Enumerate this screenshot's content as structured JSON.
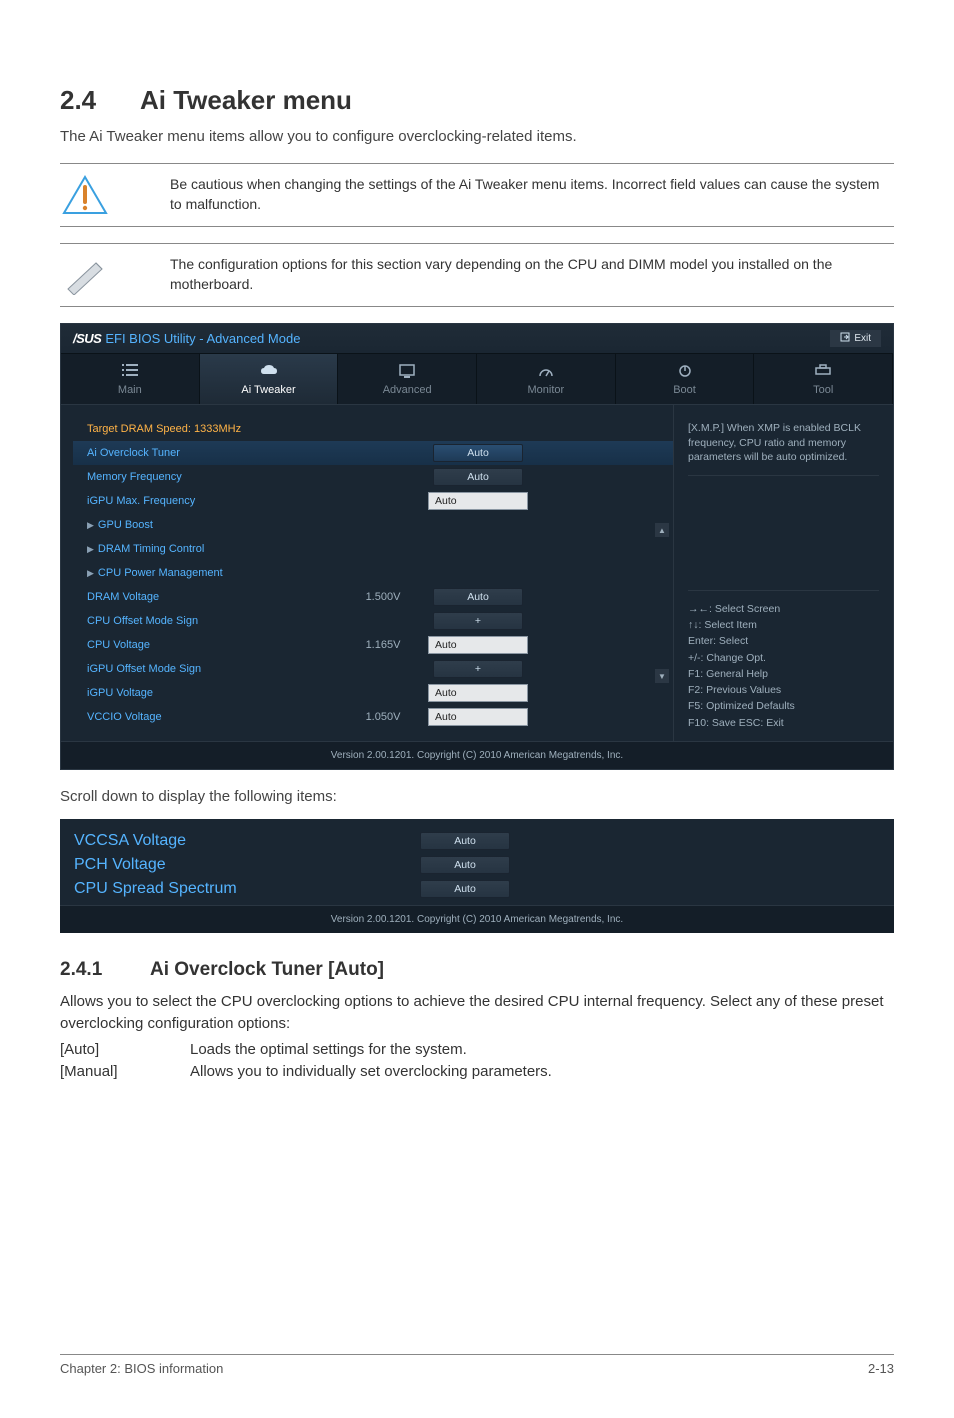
{
  "heading": {
    "num": "2.4",
    "title": "Ai Tweaker menu"
  },
  "intro": "The Ai Tweaker menu items allow you to configure overclocking-related items.",
  "note1": "Be cautious when changing the settings of the Ai Tweaker menu items. Incorrect field values can cause the system to malfunction.",
  "note2": "The configuration options for this section vary depending on the CPU and DIMM model you installed on the motherboard.",
  "bios": {
    "brand": "/SUS",
    "title": "EFI BIOS Utility - Advanced Mode",
    "exit": "Exit",
    "tabs": {
      "main": "Main",
      "tweaker": "Ai  Tweaker",
      "advanced": "Advanced",
      "monitor": "Monitor",
      "boot": "Boot",
      "tool": "Tool"
    },
    "rows": {
      "target_dram": "Target DRAM Speed: 1333MHz",
      "ai_overclock": "Ai Overclock Tuner",
      "mem_freq": "Memory Frequency",
      "igpu_max": "iGPU Max. Frequency",
      "gpu_boost": "GPU Boost",
      "dram_timing": "DRAM Timing Control",
      "cpu_pm": "CPU Power Management",
      "dram_voltage": "DRAM Voltage",
      "cpu_offset_sign": "CPU Offset Mode Sign",
      "cpu_voltage": "CPU Voltage",
      "igpu_offset_sign": "iGPU Offset Mode Sign",
      "igpu_voltage": "iGPU Voltage",
      "vccio": "VCCIO Voltage"
    },
    "mids": {
      "dram_v": "1.500V",
      "cpu_v": "1.165V",
      "vccio_v": "1.050V"
    },
    "vals": {
      "auto": "Auto",
      "plus": "+"
    },
    "help_top": "[X.M.P.] When XMP is enabled BCLK frequency, CPU ratio and memory parameters will be auto optimized.",
    "help_keys": "→←:  Select Screen\n↑↓:  Select Item\nEnter:  Select\n+/-:  Change Opt.\nF1:  General Help\nF2:  Previous Values\nF5:  Optimized Defaults\nF10:  Save   ESC:  Exit",
    "footer": "Version  2.00.1201.   Copyright  (C)  2010  American  Megatrends,  Inc."
  },
  "scroll_hint": "Scroll down to display the following items:",
  "bios2": {
    "rows": {
      "vccsa": "VCCSA Voltage",
      "pch": "PCH Voltage",
      "spread": "CPU Spread Spectrum"
    }
  },
  "subsection": {
    "num": "2.4.1",
    "title": "Ai Overclock Tuner [Auto]",
    "body": "Allows you to select the CPU overclocking options to achieve the desired CPU internal frequency. Select any of these preset overclocking configuration options:",
    "opts": {
      "auto_k": "[Auto]",
      "auto_v": "Loads the optimal settings for the system.",
      "manual_k": "[Manual]",
      "manual_v": "Allows you to individually set overclocking parameters."
    }
  },
  "footer": {
    "left": "Chapter 2: BIOS information",
    "right": "2-13"
  }
}
